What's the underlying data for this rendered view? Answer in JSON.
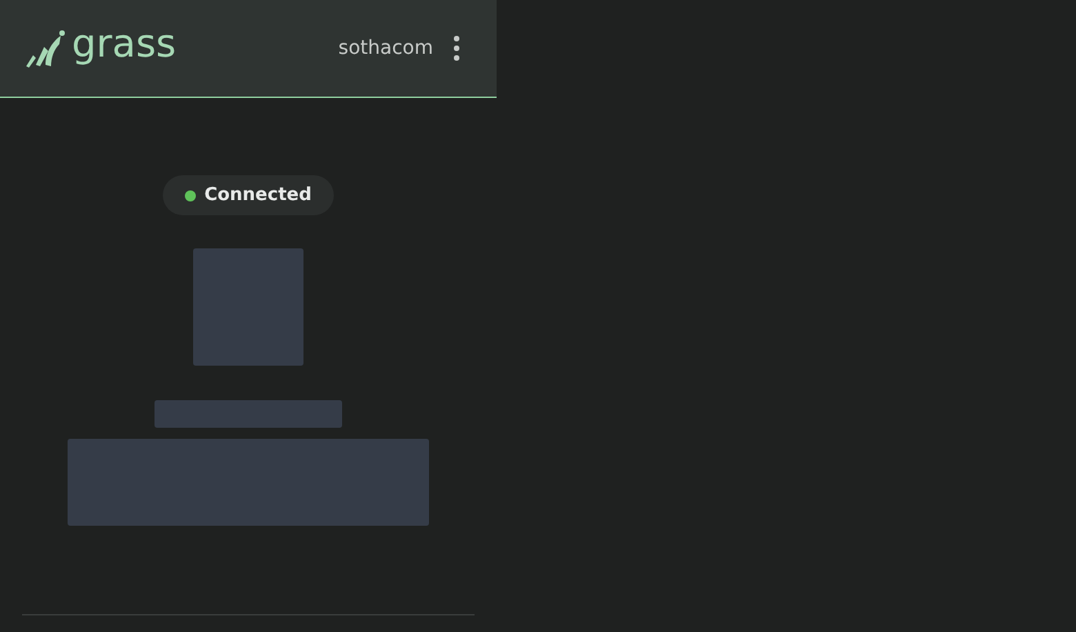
{
  "header": {
    "logo_text": "grass",
    "username": "sothacom"
  },
  "status": {
    "label": "Connected",
    "connected": true
  }
}
